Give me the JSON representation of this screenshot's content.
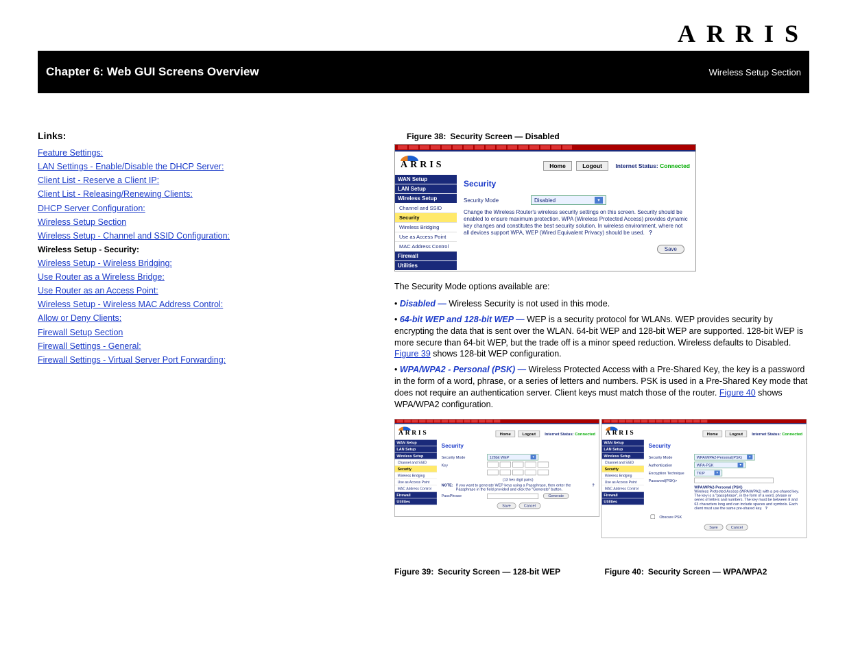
{
  "brand": "ARRIS",
  "header": {
    "chapter": "Chapter 6: Web GUI Screens Overview",
    "section": "Wireless Setup Section"
  },
  "toc": {
    "title": "Links:",
    "items": [
      {
        "level": 1,
        "text": "Feature Settings:"
      },
      {
        "level": 1,
        "text": "LAN Settings - Enable/Disable the DHCP Server:"
      },
      {
        "level": 1,
        "text": "Client List - Reserve a Client IP:"
      },
      {
        "level": 1,
        "text": "Client List - Releasing/Renewing Clients:"
      },
      {
        "level": 1,
        "text": "DHCP Server Configuration:"
      },
      {
        "level": 1,
        "text": "Wireless Setup Section"
      },
      {
        "level": 1,
        "text": "Wireless Setup - Channel and SSID Configuration:"
      },
      {
        "level": 1,
        "text": "Wireless Setup - Security:"
      },
      {
        "level": 1,
        "text": "Wireless Setup - Wireless Bridging:"
      },
      {
        "level": 2,
        "text": "Use Router as a Wireless Bridge:"
      },
      {
        "level": 2,
        "text": "Use Router as an Access Point:"
      },
      {
        "level": 1,
        "text": "Wireless Setup - Wireless MAC Address Control:"
      },
      {
        "level": 2,
        "text": "Allow or Deny Clients:"
      },
      {
        "level": 1,
        "text": "Firewall Setup Section"
      },
      {
        "level": 1,
        "text": "Firewall Settings - General:"
      },
      {
        "level": 1,
        "text": "Firewall Settings - Virtual Server Port Forwarding:"
      }
    ]
  },
  "fig38": {
    "label": "Figure 38:",
    "text": "Security Screen — Disabled"
  },
  "shot1": {
    "topnav": {
      "home": "Home",
      "logout": "Logout",
      "status_label": "Internet Status:",
      "status_value": "Connected"
    },
    "side": {
      "wan": "WAN Setup",
      "lan": "LAN Setup",
      "wireless": "Wireless Setup",
      "sub": [
        "Channel and SSID",
        "Security",
        "Wireless Bridging",
        "Use as Access Point",
        "MAC Address Control"
      ],
      "firewall": "Firewall",
      "utilities": "Utilities"
    },
    "main": {
      "title": "Security",
      "mode_label": "Security Mode",
      "mode_value": "Disabled",
      "desc": "Change the Wireless Router's wireless security settings on this screen. Security should be enabled to ensure maximum protection. WPA (Wireless Protected Access) provides dynamic key changes and constitutes the best security solution. In wireless environment, where not all devices support WPA, WEP (Wired Equivalent Privacy) should be used.",
      "help": "?",
      "save": "Save"
    }
  },
  "desc": {
    "intro": "The Security Mode options available are:",
    "disabled": [
      "Disabled — ",
      "Wireless Security is not used in this mode."
    ],
    "wep": [
      "64-bit WEP and 128-bit WEP — ",
      "WEP is a security protocol for WLANs. WEP provides security by encrypting the data that is sent over the WLAN. 64-bit WEP and 128-bit WEP are supported. 128-bit WEP is more secure than 64-bit WEP, but the trade off is a minor speed reduction. Wireless defaults to Disabled. ",
      "Figure 39",
      " shows 128-bit WEP configuration."
    ],
    "wpa": [
      "WPA/WPA2 - Personal (PSK) — ",
      "Wireless Protected Access with a Pre-Shared Key, the key is a password in the form of a word, phrase, or a series of letters and numbers. PSK is used in a Pre-Shared Key mode that does not require an authentication server. Client keys must match those of the router. ",
      "Figure 40",
      " shows WPA/WPA2 configuration."
    ]
  },
  "fig39": {
    "label": "Figure 39:",
    "text": "Security Screen — 128-bit WEP"
  },
  "fig40": {
    "label": "Figure 40:",
    "text": "Security Screen — WPA/WPA2"
  },
  "shot2": {
    "main": {
      "title": "Security",
      "mode_label": "Security Mode",
      "mode_value": "128bit WEP",
      "key_label": "Key",
      "hint": "(13 hex digit pairs)",
      "note_label": "NOTE:",
      "note_text": "If you want to generate WEP keys using a Passphrase, then enter the Passphrase in the field provided and click the \"Generate\" button.",
      "pass_label": "PassPhrase",
      "generate": "Generate",
      "save": "Save",
      "cancel": "Cancel"
    }
  },
  "shot3": {
    "main": {
      "title": "Security",
      "mode_label": "Security Mode",
      "mode_value": "WPA/WPA2-Personal(PSK)",
      "auth_label": "Authentication",
      "auth_value": "WPA-PSK",
      "enc_label": "Encryption Technique",
      "enc_value": "TKIP",
      "psk_label": "Password(PSK)>",
      "note_title": "WPA/WPA2-Personal (PSK)",
      "note_text": "Wireless Protected Access (WPA/WPA2) with a pre-shared key. The key is a \"passphrase\", in the form of a word, phrase or series of letters and numbers. The key must be between 8 and 63 characters long and can include spaces and symbols. Each client must use the same pre-shared key.",
      "help": "?",
      "obscure_label": "Obscure PSK",
      "save": "Save",
      "cancel": "Cancel"
    }
  }
}
